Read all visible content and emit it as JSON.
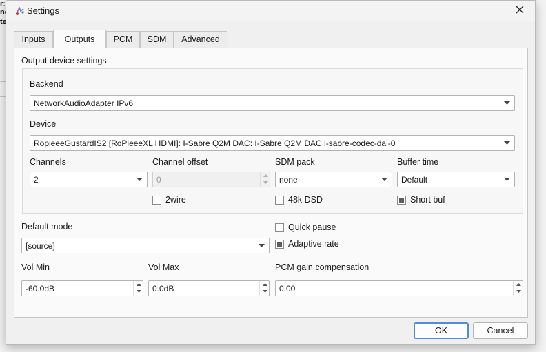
{
  "background_app": {
    "fragments": [
      "r:",
      "ne",
      "te"
    ]
  },
  "window": {
    "title": "Settings"
  },
  "tabs": [
    {
      "label": "Inputs",
      "active": false
    },
    {
      "label": "Outputs",
      "active": true
    },
    {
      "label": "PCM",
      "active": false
    },
    {
      "label": "SDM",
      "active": false
    },
    {
      "label": "Advanced",
      "active": false
    }
  ],
  "output_device": {
    "group_title": "Output device settings",
    "backend": {
      "label": "Backend",
      "value": "NetworkAudioAdapter IPv6"
    },
    "device": {
      "label": "Device",
      "value": "RopieeeGustardIS2 [RoPieeeXL HDMI]: I-Sabre Q2M DAC: I-Sabre Q2M DAC i-sabre-codec-dai-0"
    },
    "channels": {
      "label": "Channels",
      "value": "2"
    },
    "channel_offset": {
      "label": "Channel offset",
      "value": "0",
      "enabled": false
    },
    "sdm_pack": {
      "label": "SDM pack",
      "value": "none"
    },
    "buffer_time": {
      "label": "Buffer time",
      "value": "Default"
    },
    "two_wire": {
      "label": "2wire",
      "checked": false
    },
    "dsd_48k": {
      "label": "48k DSD",
      "checked": false
    },
    "short_buf": {
      "label": "Short buf",
      "state": "partial"
    }
  },
  "default_mode": {
    "label": "Default mode",
    "value": "[source]"
  },
  "quick_pause": {
    "label": "Quick pause",
    "checked": false
  },
  "adaptive_rate": {
    "label": "Adaptive rate",
    "state": "partial"
  },
  "vol_min": {
    "label": "Vol Min",
    "value": "-60.0dB"
  },
  "vol_max": {
    "label": "Vol Max",
    "value": "0.0dB"
  },
  "pcm_gain": {
    "label": "PCM gain compensation",
    "value": "0.00"
  },
  "buttons": {
    "ok": "OK",
    "cancel": "Cancel"
  },
  "icons": {
    "app": "app-icon",
    "close": "close-icon",
    "dropdown": "chevron-down-icon",
    "spin_up": "spin-up-icon",
    "spin_down": "spin-down-icon"
  },
  "colors": {
    "dialog_bg": "#f0f0f0",
    "panel_bg": "#fafafa",
    "default_button_border": "#4f8dd6"
  }
}
